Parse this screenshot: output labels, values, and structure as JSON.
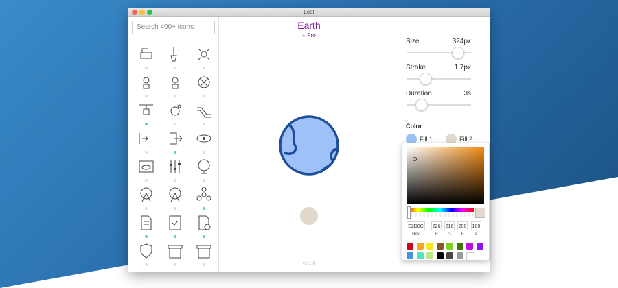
{
  "window": {
    "title": "Loaf"
  },
  "search": {
    "placeholder": "Search 400+ icons"
  },
  "preview": {
    "icon_name": "Earth",
    "badge": "Pro",
    "version": "v1.1.0",
    "fill1_color": "#9ec2f7",
    "stroke_color": "#1f4e9b",
    "fill2_color": "#e2d8cc"
  },
  "controls": {
    "size": {
      "label": "Size",
      "value": "324px",
      "level": 0.78
    },
    "stroke": {
      "label": "Stroke",
      "value": "1.7px",
      "level": 0.28
    },
    "duration": {
      "label": "Duration",
      "value": "3s",
      "level": 0.22
    }
  },
  "color": {
    "heading": "Color",
    "fill1": {
      "label": "Fill 1",
      "color": "#9ec2f7"
    },
    "fill2": {
      "label": "Fill 2",
      "color": "#e2d8cc"
    }
  },
  "picker": {
    "hex": "E2D8C",
    "r": "226",
    "g": "216",
    "b": "200",
    "a": "100",
    "hex_label": "Hex",
    "r_label": "R",
    "g_label": "G",
    "b_label": "B",
    "a_label": "A",
    "palette": [
      "#d0021b",
      "#f5a623",
      "#f8e71c",
      "#8b572a",
      "#7ed321",
      "#417505",
      "#bd10e0",
      "#9013fe",
      "#4a90e2",
      "#50e3c2",
      "#b8e986",
      "#000000",
      "#4a4a4a",
      "#9b9b9b",
      "#ffffff"
    ]
  },
  "icons": [
    {
      "name": "oil-pump-icon",
      "active": false
    },
    {
      "name": "test-tube-icon",
      "active": false
    },
    {
      "name": "drone-icon",
      "active": false
    },
    {
      "name": "drone-package-icon",
      "active": false
    },
    {
      "name": "drone-delivery-icon",
      "active": false
    },
    {
      "name": "drone-top-icon",
      "active": false
    },
    {
      "name": "cable-lift-icon",
      "active": true
    },
    {
      "name": "satellite-icon",
      "active": false
    },
    {
      "name": "escalator-icon",
      "active": false
    },
    {
      "name": "exit-arrow-person-icon",
      "active": false
    },
    {
      "name": "logout-icon",
      "active": true
    },
    {
      "name": "eye-icon",
      "active": false
    },
    {
      "name": "browser-eye-icon",
      "active": false
    },
    {
      "name": "equalizer-icon",
      "active": false
    },
    {
      "name": "fan-icon",
      "active": false
    },
    {
      "name": "ferris-wheel-icon",
      "active": false
    },
    {
      "name": "ferris-wheel-alt-icon",
      "active": false
    },
    {
      "name": "fidget-spinner-icon",
      "active": true
    },
    {
      "name": "document-icon",
      "active": true
    },
    {
      "name": "document-check-icon",
      "active": true
    },
    {
      "name": "document-add-icon",
      "active": true
    },
    {
      "name": "fire-shield-icon",
      "active": false
    },
    {
      "name": "fireplace-icon",
      "active": false
    },
    {
      "name": "fireplace-alt-icon",
      "active": false
    }
  ]
}
